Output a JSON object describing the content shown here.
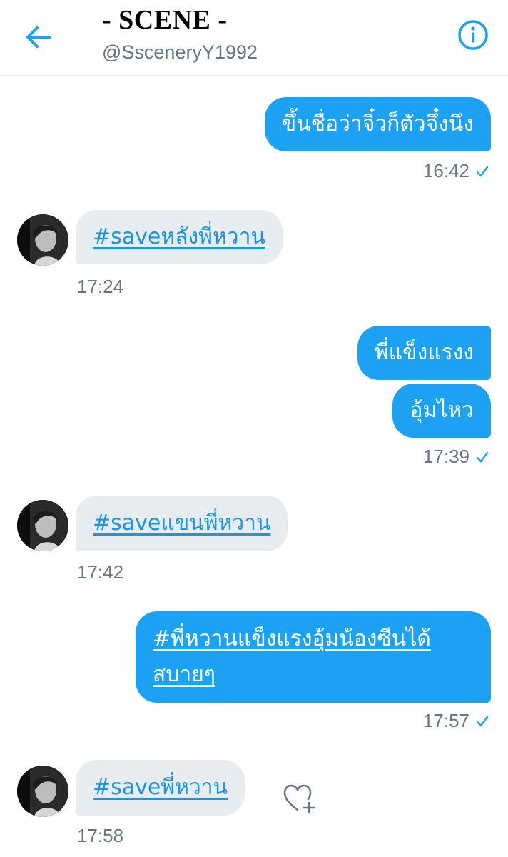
{
  "header": {
    "title": "- SCENE -",
    "handle": "@SsceneryY1992",
    "back_icon": "arrow-left-icon",
    "info_icon": "info-circle-icon"
  },
  "colors": {
    "accent": "#1da1f2",
    "link": "#1b95e0",
    "incoming_bg": "#e6ecf0",
    "timestamp": "#657786"
  },
  "messages": [
    {
      "direction": "out",
      "text": "ขึ้นชื่อว่าจิ๋วก็ตัวจึ๋งนึง",
      "time": "16:42",
      "read": true
    },
    {
      "direction": "in",
      "text": "#saveหลังพี่หวาน",
      "time": "17:24"
    },
    {
      "direction": "out",
      "text": "พี่แข็งแรงง"
    },
    {
      "direction": "out",
      "text": "อุ้มไหว",
      "time": "17:39",
      "read": true
    },
    {
      "direction": "in",
      "text": "#saveแขนพี่หวาน",
      "time": "17:42"
    },
    {
      "direction": "out",
      "text_line1": "#พี่หวานแข็งแรงอุ้มน้องซีนได้",
      "text_line2": "สบายๆ",
      "time": "17:57",
      "read": true
    },
    {
      "direction": "in",
      "text": "#saveพี่หวาน",
      "time": "17:58",
      "reaction_icon": "heart-plus-icon"
    }
  ]
}
